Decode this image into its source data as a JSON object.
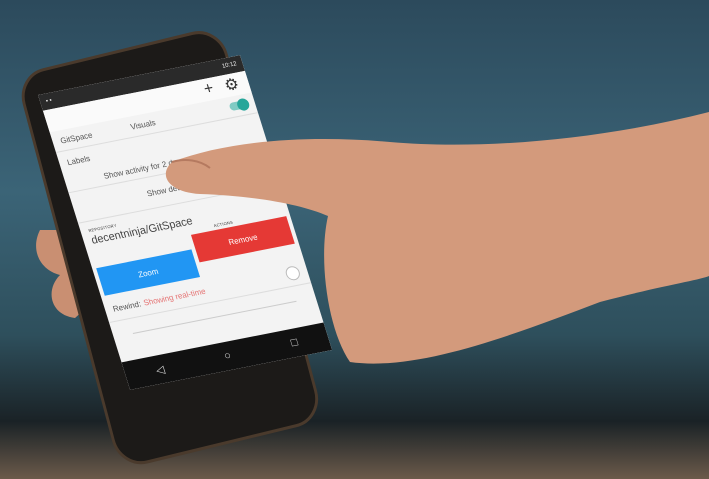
{
  "status_bar": {
    "time": "10:12"
  },
  "toolbar": {
    "add_icon": "plus-icon",
    "settings_icon": "gear-icon"
  },
  "app": {
    "title": "GitSpace"
  },
  "settings": {
    "visuals_label": "Visuals",
    "visuals_enabled": true,
    "labels_label": "Labels",
    "activity_text": "Show activity for 2 days, 9 hours ago",
    "details_text": "Show details for"
  },
  "repository": {
    "section_label": "REPOSITORY",
    "name": "decentninja/GitSpace",
    "actions_label": "ACTIONS",
    "zoom_label": "Zoom",
    "remove_label": "Remove"
  },
  "rewind": {
    "label": "Rewind:",
    "status": "Showing real-time",
    "value": 1.0
  },
  "colors": {
    "accent": "#26a69a",
    "zoom": "#2196f3",
    "remove": "#e53935",
    "rewind_status": "#e57373"
  },
  "nav": {
    "back": "back-icon",
    "home": "home-icon",
    "recents": "recents-icon"
  }
}
